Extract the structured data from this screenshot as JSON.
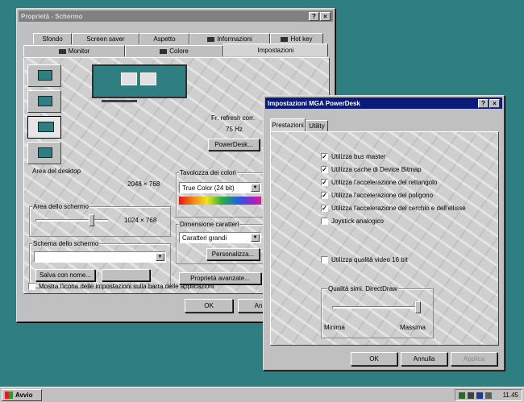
{
  "props_window": {
    "title": "Proprietà - Schermo",
    "tabs_back": [
      "Sfondo",
      "Screen saver",
      "Aspetto",
      "Informazioni",
      "Hot key"
    ],
    "tabs_front": [
      "Monitor",
      "Colore",
      "Impostazioni"
    ],
    "selected_tab": "Impostazioni",
    "refresh_label": "Fr. refresh corr.",
    "refresh_value": "75 Hz",
    "powerdesk_button": "PowerDesk...",
    "desktop_area_label": "Area del desktop",
    "desktop_area_value": "2048 × 768",
    "screen_area_label": "Area dello schermo",
    "screen_area_value": "1024 × 768",
    "screen_area_slider_level": 0.8,
    "color_palette_label": "Tavolozza dei colori",
    "color_palette_value": "True Color (24 bit)",
    "font_size_label": "Dimensione caratteri",
    "font_size_value": "Caratteri grandi",
    "customize_button": "Personalizza...",
    "screen_scheme_label": "Schema dello schermo",
    "screen_scheme_value": "",
    "save_as_button": "Salva con nome...",
    "advanced_props_button": "Proprietà avanzate...",
    "show_icon_checkbox": "Mostra l'icona delle impostazioni sulla barra delle applicazioni",
    "show_icon_checked": false,
    "ok_button": "OK",
    "cancel_button": "Annu"
  },
  "mga_window": {
    "title": "Impostazioni MGA PowerDesk",
    "tabs": [
      "Prestazioni",
      "Utility"
    ],
    "selected_tab": "Prestazioni",
    "options": [
      {
        "label": "Utilizza bus master",
        "checked": true
      },
      {
        "label": "Utilizza cache di Device Bitmap",
        "checked": true
      },
      {
        "label": "Utilizza l'accelerazione del rettangolo",
        "checked": true
      },
      {
        "label": "Utilizza l'accelerazione del poligono",
        "checked": true
      },
      {
        "label": "Utilizza l'accelerazione del cerchio e dell'ellisse",
        "checked": true
      },
      {
        "label": "Joystick analogico",
        "checked": false
      }
    ],
    "video_option": {
      "label": "Utilizza qualità video 16 bit",
      "checked": false
    },
    "quality_group_label": "Qualità simi. DirectDraw",
    "quality_min": "Minima",
    "quality_max": "Massima",
    "quality_level": 1.0,
    "ok_button": "OK",
    "cancel_button": "Annulla",
    "apply_button": "Applica"
  },
  "taskbar": {
    "start_label": "Avvio",
    "clock": "11.45"
  },
  "colors": {
    "desktop": "#2f7e82",
    "active_title": "#0a1a78",
    "inactive_title": "#808080"
  }
}
